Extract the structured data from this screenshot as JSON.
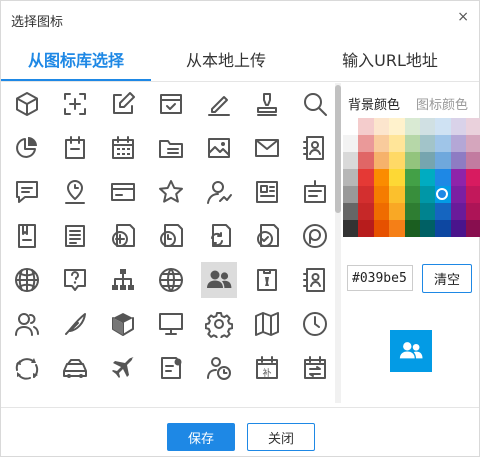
{
  "dialog": {
    "title": "选择图标",
    "close_glyph": "×"
  },
  "tabs": [
    {
      "label": "从图标库选择",
      "active": true
    },
    {
      "label": "从本地上传",
      "active": false
    },
    {
      "label": "输入URL地址",
      "active": false
    }
  ],
  "icons": [
    [
      "cube-icon",
      "add-frame-icon",
      "edit-icon",
      "calendar-check-icon",
      "pen-line-icon",
      "stamp-icon",
      "search-icon"
    ],
    [
      "pie-chart-icon",
      "calendar-minus-icon",
      "calendar-grid-icon",
      "folder-list-icon",
      "image-icon",
      "mail-icon",
      "contact-card-icon"
    ],
    [
      "chat-icon",
      "location-time-icon",
      "credit-card-icon",
      "star-icon",
      "user-trend-icon",
      "news-icon",
      "tag-card-icon"
    ],
    [
      "book-icon",
      "document-list-icon",
      "file-add-icon",
      "file-clock-icon",
      "file-refresh-icon",
      "file-check-icon",
      "circle-p-icon"
    ],
    [
      "globe-grid-icon",
      "help-chat-icon",
      "org-chart-icon",
      "globe-icon",
      "users-icon",
      "id-badge-icon",
      "address-book-icon"
    ],
    [
      "user-group-icon",
      "feather-icon",
      "box-3d-icon",
      "monitor-icon",
      "gear-icon",
      "map-icon",
      "clock-icon"
    ],
    [
      "cycle-arrows-icon",
      "car-icon",
      "airplane-icon",
      "file-user-icon",
      "user-clock-icon",
      "calendar-supplement-icon",
      "calendar-swap-icon"
    ]
  ],
  "selected_icon": "users-icon",
  "color_panel": {
    "bg_tab_label": "背景颜色",
    "icon_tab_label": "图标颜色",
    "hex_value": "#039be5",
    "clear_label": "清空",
    "selected_color": "#039be5",
    "palette": [
      [
        "#ffffff",
        "#f4cccc",
        "#fce5cd",
        "#fff2cc",
        "#d9ead3",
        "#d0e0e3",
        "#cfe2f3",
        "#d9d2e9",
        "#ead1dc"
      ],
      [
        "#f3f3f3",
        "#ea9999",
        "#f9cb9c",
        "#ffe599",
        "#b6d7a8",
        "#a2c4c9",
        "#9fc5e8",
        "#b4a7d6",
        "#d5a6bd"
      ],
      [
        "#d9d9d9",
        "#e06666",
        "#f6b26b",
        "#ffd966",
        "#93c47d",
        "#76a5af",
        "#6fa8dc",
        "#8e7cc3",
        "#c27ba0"
      ],
      [
        "#b7b7b7",
        "#e53935",
        "#fb8c00",
        "#fdd835",
        "#43a047",
        "#00acc1",
        "#1e88e5",
        "#8e24aa",
        "#d81b60"
      ],
      [
        "#999999",
        "#d32f2f",
        "#f57c00",
        "#fbc02d",
        "#388e3c",
        "#0097a7",
        "#039be5",
        "#7b1fa2",
        "#c2185b"
      ],
      [
        "#666666",
        "#c62828",
        "#ef6c00",
        "#f9a825",
        "#2e7d32",
        "#00838f",
        "#1565c0",
        "#6a1b9a",
        "#ad1457"
      ],
      [
        "#333333",
        "#b71c1c",
        "#e65100",
        "#f57f17",
        "#1b5e20",
        "#006064",
        "#0d47a1",
        "#4a148c",
        "#880e4f"
      ]
    ],
    "calendar_supplement_char": "补"
  },
  "footer": {
    "save_label": "保存",
    "close_label": "关闭"
  }
}
